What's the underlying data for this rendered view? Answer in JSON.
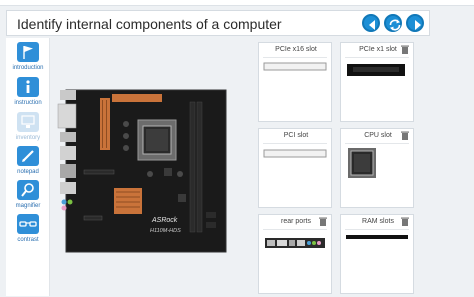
{
  "header": {
    "title": "Identify internal components of a computer"
  },
  "nav": {
    "back_icon": "back-arrow-icon",
    "reset_icon": "reset-icon",
    "forward_icon": "forward-arrow-icon"
  },
  "sidebar": {
    "items": [
      {
        "label": "introduction",
        "icon": "flag-icon"
      },
      {
        "label": "instruction",
        "icon": "info-icon"
      },
      {
        "label": "inventory",
        "icon": "monitor-icon"
      },
      {
        "label": "notepad",
        "icon": "pencil-icon"
      },
      {
        "label": "magnifier",
        "icon": "magnifier-icon"
      },
      {
        "label": "contrast",
        "icon": "glasses-icon"
      }
    ]
  },
  "board": {
    "brand": "ASRock",
    "model": "H110M-HDS"
  },
  "slots": [
    {
      "label": "PCIe x16 slot",
      "content": "pcie-x16-slot"
    },
    {
      "label": "PCIe x1 slot",
      "content": "pcie-x1-card"
    },
    {
      "label": "PCI slot",
      "content": "pci-slot"
    },
    {
      "label": "CPU slot",
      "content": "cpu-socket"
    },
    {
      "label": "rear ports",
      "content": "rear-ports"
    },
    {
      "label": "RAM slots",
      "content": "ram-slot"
    }
  ],
  "colors": {
    "accent": "#1c8fd6",
    "sidebar_label": "#2a6fb0",
    "board": "#1a1a1a",
    "heatsink": "#c9733a"
  }
}
